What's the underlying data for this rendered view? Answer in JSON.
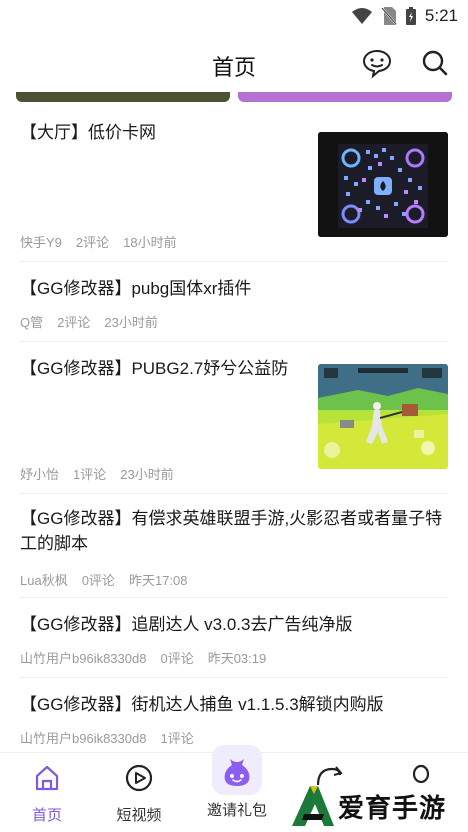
{
  "status_bar": {
    "time": "5:21"
  },
  "header": {
    "title": "首页",
    "chat_icon": "chat-bubble-icon",
    "search_icon": "search-icon"
  },
  "banners": {
    "left_color": "#4a5233",
    "right_color": "#b570d4"
  },
  "posts": [
    {
      "title": "【大厅】低价卡网",
      "author": "快手Y9",
      "comments": "2评论",
      "time": "18小时前",
      "thumbnail": "qr-code"
    },
    {
      "title": "【GG修改器】pubg国体xr插件",
      "author": "Q管",
      "comments": "2评论",
      "time": "23小时前"
    },
    {
      "title": "【GG修改器】PUBG2.7妤兮公益防",
      "author": "妤小怡",
      "comments": "1评论",
      "time": "23小时前",
      "thumbnail": "game-screenshot"
    },
    {
      "title": "【GG修改器】有偿求英雄联盟手游,火影忍者或者量子特工的脚本",
      "author": "Lua秋枫",
      "comments": "0评论",
      "time": "昨天17:08"
    },
    {
      "title": "【GG修改器】追剧达人 v3.0.3去广告纯净版",
      "author": "山竹用户b96ik8330d8",
      "comments": "0评论",
      "time": "昨天03:19"
    },
    {
      "title": "【GG修改器】街机达人捕鱼 v1.1.5.3解锁内购版",
      "author": "山竹用户b96ik8330d8",
      "comments": "1评论",
      "time": ""
    }
  ],
  "tabbar": {
    "items": [
      {
        "label": "首页",
        "icon": "home-icon",
        "active": true
      },
      {
        "label": "短视频",
        "icon": "play-circle-icon"
      },
      {
        "label": "邀请礼包",
        "icon": "gift-bag-icon"
      },
      {
        "label": "",
        "icon": "discover-icon"
      },
      {
        "label": "",
        "icon": "profile-icon"
      }
    ]
  },
  "watermark": {
    "text": "爱育手游网"
  },
  "colors": {
    "accent": "#7b5be0",
    "meta_gray": "#9a9a9a"
  }
}
